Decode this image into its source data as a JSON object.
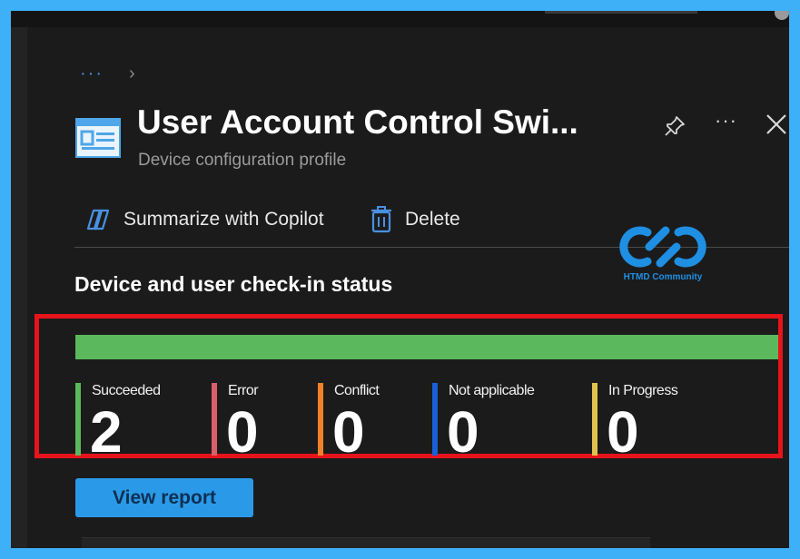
{
  "header": {
    "breadcrumb_ellipsis": "···",
    "breadcrumb_chevron": "›",
    "title": "User Account Control Swi...",
    "subtitle": "Device configuration profile",
    "more": "···"
  },
  "commands": {
    "copilot_label": "Summarize with Copilot",
    "delete_label": "Delete"
  },
  "watermark": {
    "text": "HTMD Community"
  },
  "checkin": {
    "section_title": "Device and user check-in status",
    "progress_succeeded_fraction": 1.0,
    "stats": [
      {
        "label": "Succeeded",
        "value": "2",
        "color": "#5cb85c"
      },
      {
        "label": "Error",
        "value": "0",
        "color": "#d9606b"
      },
      {
        "label": "Conflict",
        "value": "0",
        "color": "#f0812a"
      },
      {
        "label": "Not applicable",
        "value": "0",
        "color": "#1a5fd6"
      },
      {
        "label": "In Progress",
        "value": "0",
        "color": "#e2c14f"
      }
    ],
    "view_report_label": "View report"
  },
  "colors": {
    "outer_border": "#3db0f7",
    "highlight_box": "#e8131b",
    "accent": "#2a9ae8"
  }
}
